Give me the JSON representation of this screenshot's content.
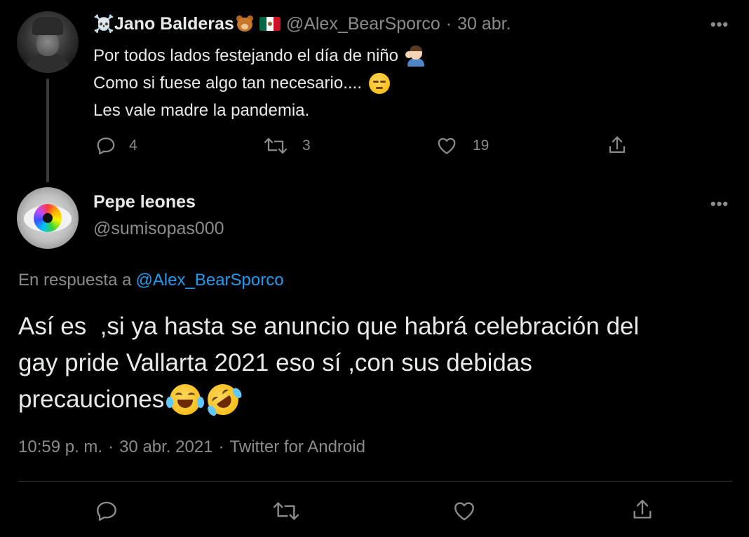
{
  "parent_tweet": {
    "name_prefix_emoji": "☠️",
    "display_name": "Jano Balderas",
    "handle": "@Alex_BearSporco",
    "separator": "·",
    "date": "30 abr.",
    "lines": [
      "Por todos lados festejando el día de niño",
      "Como si fuese algo tan necesario....",
      "Les vale madre la pandemia."
    ],
    "actions": {
      "reply_count": "4",
      "retweet_count": "3",
      "like_count": "19"
    }
  },
  "reply_tweet": {
    "display_name": "Pepe leones",
    "handle": "@sumisopas000",
    "replying_to_label": "En respuesta a",
    "replying_to_handle": "@Alex_BearSporco",
    "text_lines": [
      "Así es  ,si ya hasta se anuncio que habrá celebración del",
      "gay pride Vallarta 2021 eso sí ,con sus debidas",
      "precauciones"
    ],
    "time": "10:59 p. m.",
    "date": "30 abr. 2021",
    "source": "Twitter for Android",
    "separator": "·"
  },
  "icons": {
    "reply": "reply-icon",
    "retweet": "retweet-icon",
    "like": "heart-icon",
    "share": "share-icon",
    "more": "more-icon"
  },
  "colors": {
    "background": "#000000",
    "text_primary": "#e7e9ea",
    "text_secondary": "#8b8b8b",
    "link": "#1d9bf0",
    "divider": "#2f3336"
  }
}
